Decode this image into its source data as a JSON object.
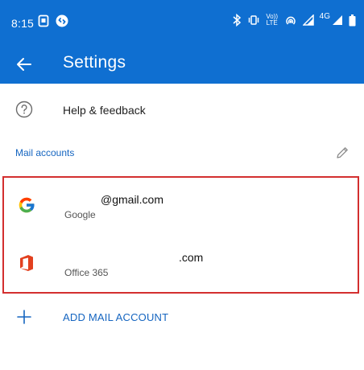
{
  "status_bar": {
    "time": "8:15",
    "network": "4G",
    "volte_label": "Vo)) LTE"
  },
  "app_bar": {
    "title": "Settings"
  },
  "help": {
    "label": "Help & feedback"
  },
  "mail_accounts": {
    "section_title": "Mail accounts",
    "accounts": [
      {
        "email": "@gmail.com",
        "provider": "Google",
        "icon": "google-icon"
      },
      {
        "email": ".com",
        "provider": "Office 365",
        "icon": "office-365-icon"
      }
    ]
  },
  "add_account": {
    "label": "ADD MAIL ACCOUNT"
  },
  "colors": {
    "brand_blue": "#0f6fd1",
    "link_blue": "#1565c0",
    "highlight_red": "#d32f2f"
  }
}
